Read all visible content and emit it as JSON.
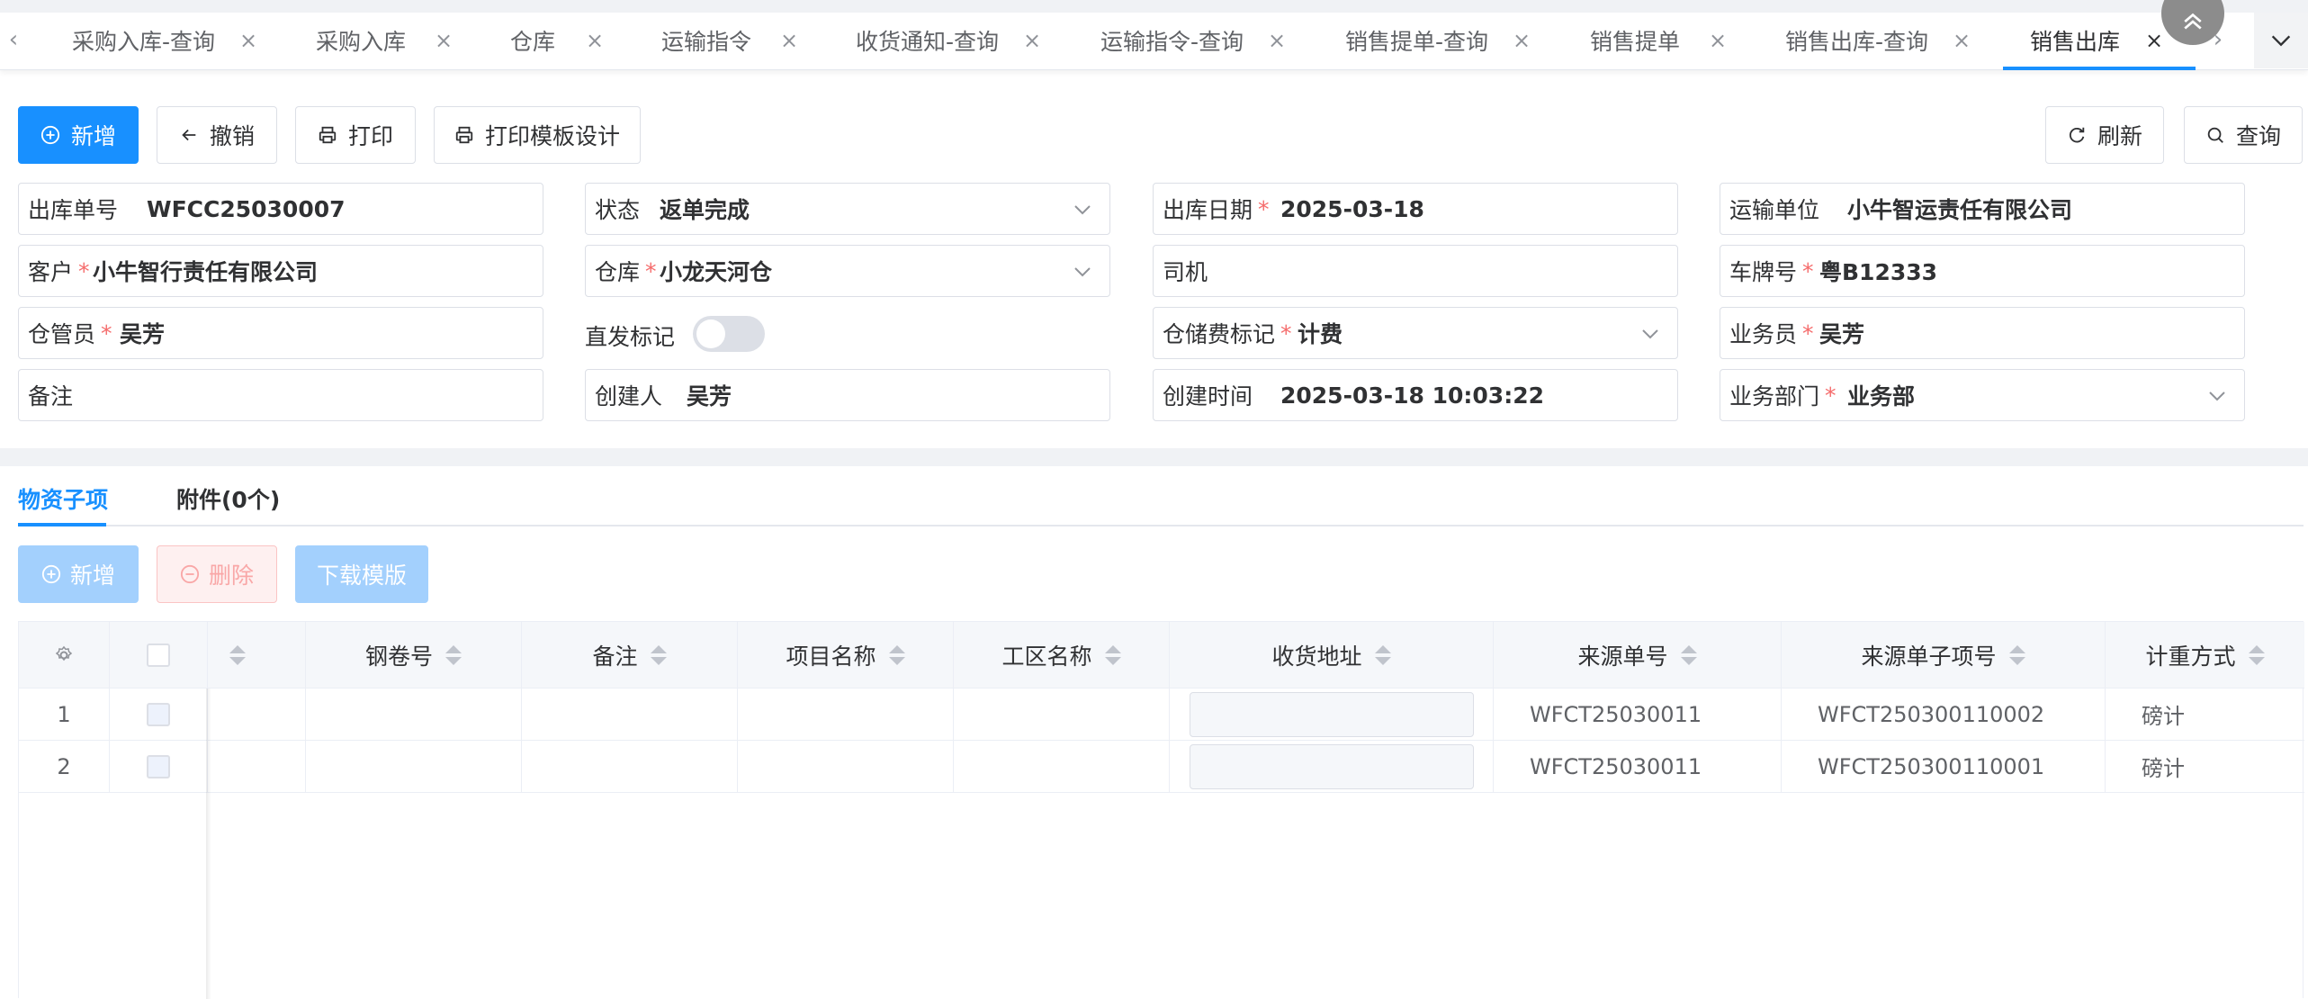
{
  "tabs": [
    {
      "label": "采购入库-查询"
    },
    {
      "label": "采购入库"
    },
    {
      "label": "仓库"
    },
    {
      "label": "运输指令"
    },
    {
      "label": "收货通知-查询"
    },
    {
      "label": "运输指令-查询"
    },
    {
      "label": "销售提单-查询"
    },
    {
      "label": "销售提单"
    },
    {
      "label": "销售出库-查询"
    },
    {
      "label": "销售出库"
    }
  ],
  "tab_close": "×",
  "toolbar": {
    "add": "新增",
    "revoke": "撤销",
    "print": "打印",
    "print_template": "打印模板设计",
    "refresh": "刷新",
    "query": "查询"
  },
  "form": {
    "outbound_no": {
      "label": "出库单号",
      "value": "WFCC25030007"
    },
    "status": {
      "label": "状态",
      "value": "返单完成"
    },
    "outbound_date": {
      "label": "出库日期",
      "value": "2025-03-18"
    },
    "carrier": {
      "label": "运输单位",
      "value": "小牛智运责任有限公司"
    },
    "customer": {
      "label": "客户",
      "value": "小牛智行责任有限公司"
    },
    "warehouse": {
      "label": "仓库",
      "value": "小龙天河仓"
    },
    "driver": {
      "label": "司机",
      "value": ""
    },
    "plate": {
      "label": "车牌号",
      "value": "粤B12333"
    },
    "keeper": {
      "label": "仓管员",
      "value": "吴芳"
    },
    "direct_flag": {
      "label": "直发标记",
      "value": false
    },
    "storage_fee": {
      "label": "仓储费标记",
      "value": "计费"
    },
    "salesman": {
      "label": "业务员",
      "value": "吴芳"
    },
    "remark": {
      "label": "备注",
      "value": ""
    },
    "creator": {
      "label": "创建人",
      "value": "吴芳"
    },
    "created_at": {
      "label": "创建时间",
      "value": "2025-03-18 10:03:22"
    },
    "department": {
      "label": "业务部门",
      "value": "业务部"
    },
    "required_mark": "*"
  },
  "subtabs": {
    "items": "物资子项",
    "attachments": "附件(0个)"
  },
  "sub_toolbar": {
    "add": "新增",
    "delete": "删除",
    "download": "下载模版"
  },
  "table": {
    "columns": [
      "钢卷号",
      "备注",
      "项目名称",
      "工区名称",
      "收货地址",
      "来源单号",
      "来源单子项号",
      "计重方式"
    ],
    "rows": [
      {
        "index": "1",
        "coil": "",
        "remark": "",
        "project": "",
        "area": "",
        "address": "",
        "source_no": "WFCT25030011",
        "source_item": "WFCT250300110002",
        "weigh": "磅计"
      },
      {
        "index": "2",
        "coil": "",
        "remark": "",
        "project": "",
        "area": "",
        "address": "",
        "source_no": "WFCT25030011",
        "source_item": "WFCT250300110001",
        "weigh": "磅计"
      }
    ]
  },
  "colors": {
    "primary": "#1890ff",
    "required": "#f56c6c"
  }
}
